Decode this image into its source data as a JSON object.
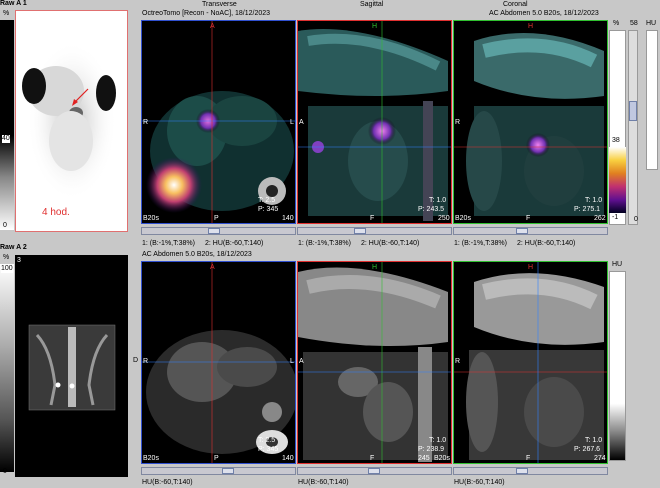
{
  "left_top": {
    "title": "Raw A 1",
    "pct_label": "%",
    "frame_num": "3",
    "scale_top": "100",
    "scale_mid": "40",
    "scale_bot": "0",
    "annotation": "4 hod."
  },
  "left_bottom": {
    "title": "Raw A 2",
    "pct_label": "%",
    "frame_num": "3",
    "scale_top": "100",
    "scale_bot": "0"
  },
  "top_row": {
    "header_left": "OctreoTomo [Recon - NoAC], 18/12/2023",
    "header_right": "AC  Abdomen  5.0  B20s, 18/12/2023",
    "views": [
      "Transverse",
      "Sagittal",
      "Coronal"
    ],
    "transverse": {
      "top": "A",
      "left": "R",
      "right": "L",
      "bottom": "P",
      "corner": "B20s",
      "t": "T: 2.5",
      "p": "P: 345",
      "slice": "140"
    },
    "sagittal": {
      "top": "H",
      "left": "A",
      "bottom": "F",
      "t": "T: 1.0",
      "p": "P: 243.5",
      "slice": "250"
    },
    "coronal": {
      "top": "H",
      "left": "R",
      "bottom": "F",
      "corner": "B20s",
      "t": "T: 1.0",
      "p": "P: 275.1",
      "slice": "262"
    },
    "wl_labels": [
      "1: (B:-1%,T:38%)",
      "2: HU(B:-60,T:140)",
      "1: (B:-1%,T:38%)",
      "2: HU(B:-60,T:140)",
      "1: (B:-1%,T:38%)",
      "2: HU(B:-60,T:140)"
    ],
    "colorbar": {
      "pct": "%",
      "top": "58",
      "mid": "38",
      "bot": "-1",
      "right_top": "0",
      "hu": "HU"
    }
  },
  "bottom_row": {
    "header_left": "AC  Abdomen  5.0  B20s, 18/12/2023",
    "transverse": {
      "top": "A",
      "left": "R",
      "right": "L",
      "bottom": "P",
      "corner": "B20s",
      "t": "T: 2.5",
      "p": "P: 345",
      "slice": "140"
    },
    "sagittal": {
      "top": "H",
      "left": "A",
      "bottom": "F",
      "t": "T: 1.0",
      "p": "P: 238.9",
      "slice": "245",
      "corner": "B20s"
    },
    "coronal": {
      "top": "H",
      "left": "R",
      "bottom": "F",
      "t": "T: 1.0",
      "p": "P: 267.6",
      "slice": "274"
    },
    "wl_labels": [
      "HU(B:-60,T:140)",
      "HU(B:-60,T:140)",
      "HU(B:-60,T:140)"
    ],
    "side_label": "D",
    "hu_label": "HU"
  }
}
